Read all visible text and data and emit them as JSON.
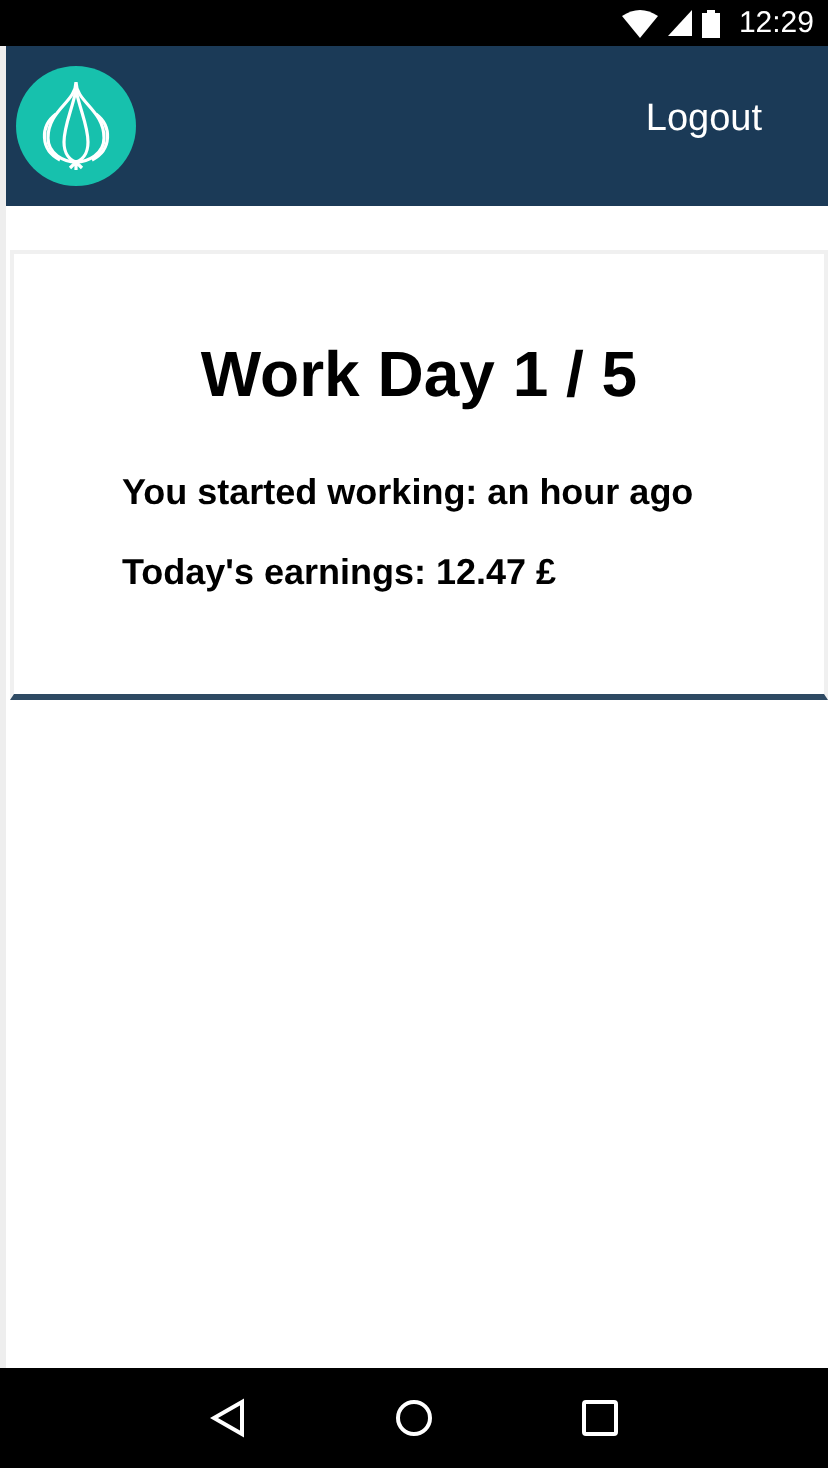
{
  "status_bar": {
    "time": "12:29"
  },
  "header": {
    "logout": "Logout"
  },
  "card": {
    "title": "Work Day 1 / 5",
    "lines": [
      "You started working: an hour ago",
      "Today's earnings: 12.47 £"
    ]
  }
}
